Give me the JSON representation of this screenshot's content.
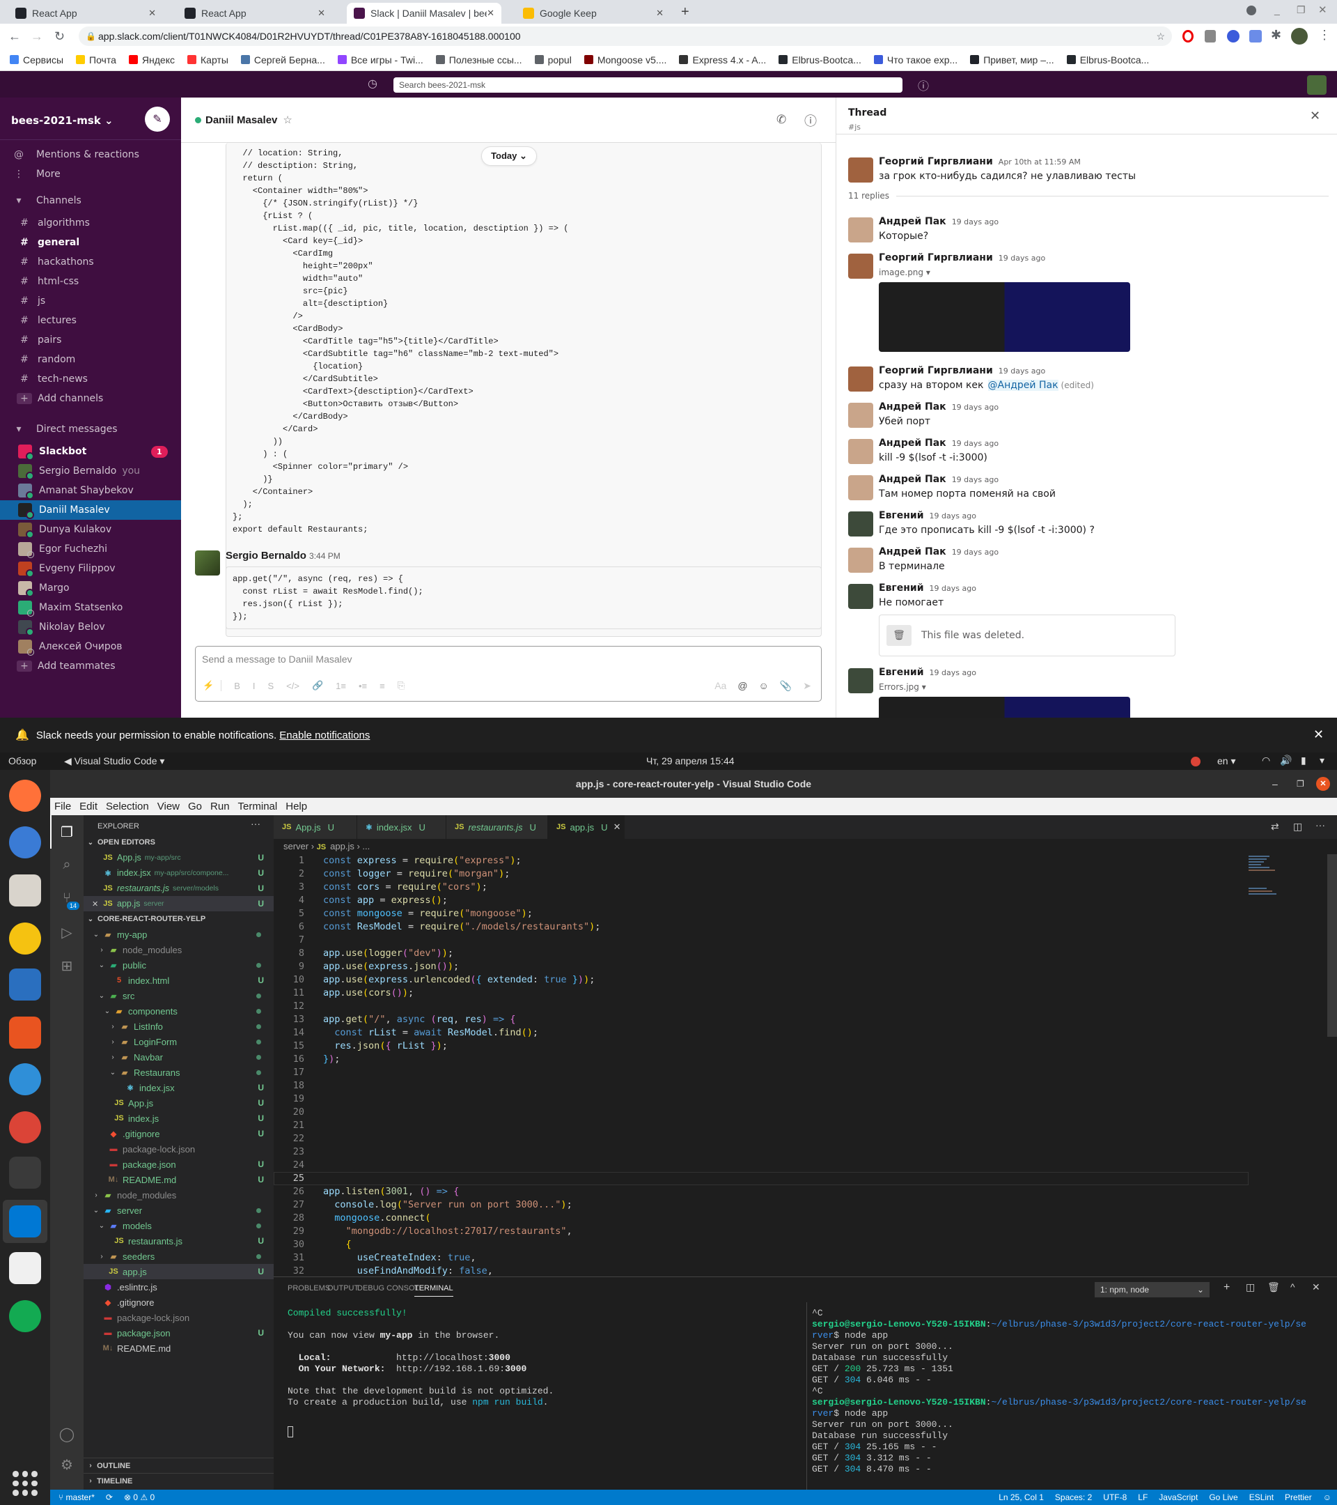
{
  "browser": {
    "tabs": [
      {
        "title": "React App",
        "color": "#20232a",
        "active": false
      },
      {
        "title": "React App",
        "color": "#20232a",
        "active": false
      },
      {
        "title": "Slack | Daniil Masalev | bees-2021-msk",
        "color": "#4a154b",
        "active": true
      },
      {
        "title": "Google Keep",
        "color": "#fbbc04",
        "active": false
      }
    ],
    "url": "app.slack.com/client/T01NWCK4084/D01R2HVUYDT/thread/C01PE378A8Y-1618045188.000100",
    "bookmarks": [
      {
        "label": "Сервисы",
        "color": "#4285f4"
      },
      {
        "label": "Почта",
        "color": "#ffcc00"
      },
      {
        "label": "Яндекс",
        "color": "#ff0000"
      },
      {
        "label": "Карты",
        "color": "#ff3333"
      },
      {
        "label": "Сергей Берна...",
        "color": "#4a76a8"
      },
      {
        "label": "Все игры - Twi...",
        "color": "#9146ff"
      },
      {
        "label": "Полезные ссы...",
        "color": "#5f6368"
      },
      {
        "label": "popul",
        "color": "#5f6368"
      },
      {
        "label": "Mongoose v5....",
        "color": "#800000"
      },
      {
        "label": "Express 4.x - A...",
        "color": "#333333"
      },
      {
        "label": "Elbrus-Bootca...",
        "color": "#24292e"
      },
      {
        "label": "Что такое exp...",
        "color": "#3b5bdb"
      },
      {
        "label": "Привет, мир –...",
        "color": "#20232a"
      },
      {
        "label": "Elbrus-Bootca...",
        "color": "#24292e"
      }
    ]
  },
  "slack": {
    "search_placeholder": "Search bees-2021-msk",
    "workspace": "bees-2021-msk",
    "mentions": "Mentions & reactions",
    "more": "More",
    "channels_header": "Channels",
    "channels": [
      "algorithms",
      "general",
      "hackathons",
      "html-css",
      "js",
      "lectures",
      "pairs",
      "random",
      "tech-news"
    ],
    "bold_channel": "general",
    "add_channels": "Add channels",
    "dm_header": "Direct messages",
    "dms": [
      {
        "name": "Slackbot",
        "badge": "1",
        "bold": true,
        "color": "#e01e5a"
      },
      {
        "name": "Sergio Bernaldo",
        "suffix": "you",
        "color": "#4b6b3a"
      },
      {
        "name": "Amanat Shaybekov",
        "color": "#6b7a99"
      },
      {
        "name": "Daniil Masalev",
        "selected": true,
        "color": "#222222"
      },
      {
        "name": "Dunya Kulakov",
        "color": "#7a5a3a"
      },
      {
        "name": "Egor Fuchezhi",
        "away": true,
        "color": "#b8a898"
      },
      {
        "name": "Evgeny Filippov",
        "color": "#c04020"
      },
      {
        "name": "Margo",
        "color": "#c8b8a8"
      },
      {
        "name": "Maxim Statsenko",
        "away": true,
        "color": "#2bac76"
      },
      {
        "name": "Nikolay Belov",
        "color": "#404850"
      },
      {
        "name": "Алексей Очиров",
        "away": true,
        "color": "#a08060"
      }
    ],
    "add_teammates": "Add teammates",
    "channel_title": "Daniil Masalev",
    "today": "Today",
    "code_message": "  // location: String,\n  // desctiption: String,\n  return (\n    <Container width=\"80%\">\n      {/* {JSON.stringify(rList)} */}\n      {rList ? (\n        rList.map(({ _id, pic, title, location, desctiption }) => (\n          <Card key={_id}>\n            <CardImg\n              height=\"200px\"\n              width=\"auto\"\n              src={pic}\n              alt={desctiption}\n            />\n            <CardBody>\n              <CardTitle tag=\"h5\">{title}</CardTitle>\n              <CardSubtitle tag=\"h6\" className=\"mb-2 text-muted\">\n                {location}\n              </CardSubtitle>\n              <CardText>{desctiption}</CardText>\n              <Button>Оставить отзыв</Button>\n            </CardBody>\n          </Card>\n        ))\n      ) : (\n        <Spinner color=\"primary\" />\n      )}\n    </Container>\n  );\n};\nexport default Restaurants;",
    "sergio": {
      "name": "Sergio Bernaldo",
      "time": "3:44 PM",
      "code": "app.get(\"/\", async (req, res) => {\n  const rList = await ResModel.find();\n  res.json({ rList });\n});"
    },
    "composer_placeholder": "Send a message to Daniil Masalev",
    "composer_tools": [
      "B",
      "I",
      "S",
      "</>",
      "🔗",
      "1≡",
      "•≡",
      "≡",
      "⎘"
    ],
    "composer_right": [
      "Aa",
      "@",
      "☺",
      "📎",
      "➤"
    ],
    "thread": {
      "title": "Thread",
      "channel": "#js",
      "parent": {
        "name": "Георгий Гиргвлиани",
        "time": "Apr 10th at 11:59 AM",
        "text": "за грок кто-нибудь садился? не улавливаю тесты"
      },
      "replies_label": "11 replies",
      "replies": [
        {
          "name": "Андрей Пак",
          "time": "19 days ago",
          "text": "Которые?",
          "av": "#c9a58a"
        },
        {
          "name": "Георгий Гиргвлиани",
          "time": "19 days ago",
          "file": "image.png",
          "av": "#a0623f"
        },
        {
          "name": "Георгий Гиргвлиани",
          "time": "19 days ago",
          "text": "сразу на втором кек",
          "mention": "@Андрей Пак",
          "edited": "(edited)",
          "av": "#a0623f"
        },
        {
          "name": "Андрей Пак",
          "time": "19 days ago",
          "text": "Убей порт",
          "av": "#c9a58a"
        },
        {
          "name": "Андрей Пак",
          "time": "19 days ago",
          "text": "kill -9 $(lsof -t -i:3000)",
          "av": "#c9a58a"
        },
        {
          "name": "Андрей Пак",
          "time": "19 days ago",
          "text": "Там  номер порта поменяй на свой",
          "av": "#c9a58a"
        },
        {
          "name": "Евгений",
          "time": "19 days ago",
          "text": "Где это прописать kill -9 $(lsof -t -i:3000) ?",
          "av": "#3d4a3a"
        },
        {
          "name": "Андрей Пак",
          "time": "19 days ago",
          "text": "В терминале",
          "av": "#c9a58a"
        },
        {
          "name": "Евгений",
          "time": "19 days ago",
          "text": "Не помогает",
          "deleted": "This file was deleted.",
          "av": "#3d4a3a"
        },
        {
          "name": "Евгений",
          "time": "19 days ago",
          "file": "Errors.jpg",
          "av": "#3d4a3a"
        }
      ]
    },
    "notification": {
      "text": "Slack needs your permission to enable notifications.",
      "link": "Enable notifications"
    }
  },
  "ubuntu": {
    "overview": "Обзор",
    "app": "Visual Studio Code",
    "datetime": "Чт, 29 апреля  15:44",
    "lang": "en"
  },
  "dock": [
    {
      "name": "firefox",
      "color": "#ff7139"
    },
    {
      "name": "thunderbird",
      "color": "#3a7bd5"
    },
    {
      "name": "files",
      "color": "#d9d4cc"
    },
    {
      "name": "rhythmbox",
      "color": "#f5c211"
    },
    {
      "name": "writer",
      "color": "#2a6fbf"
    },
    {
      "name": "app-center",
      "color": "#e95420"
    },
    {
      "name": "help",
      "color": "#2f8fd8"
    },
    {
      "name": "chrome",
      "color": "#db4437"
    },
    {
      "name": "terminal",
      "color": "#3a3a3a"
    },
    {
      "name": "vscode",
      "color": "#0078d4"
    },
    {
      "name": "text-editor",
      "color": "#f0f0f0"
    },
    {
      "name": "mongodb-compass",
      "color": "#13aa52"
    }
  ],
  "vscode": {
    "title": "app.js - core-react-router-yelp - Visual Studio Code",
    "menu": [
      "File",
      "Edit",
      "Selection",
      "View",
      "Go",
      "Run",
      "Terminal",
      "Help"
    ],
    "scm_badge": "14",
    "explorer_title": "EXPLORER",
    "open_editors_title": "OPEN EDITORS",
    "open_editors": [
      {
        "name": "App.js",
        "path": "my-app/src",
        "icon": "js",
        "status": "U"
      },
      {
        "name": "index.jsx",
        "path": "my-app/src/compone...",
        "icon": "react",
        "status": "U"
      },
      {
        "name": "restaurants.js",
        "path": "server/models",
        "icon": "js",
        "status": "U",
        "italic": true
      },
      {
        "name": "app.js",
        "path": "server",
        "icon": "js",
        "status": "U",
        "active": true
      }
    ],
    "project_title": "CORE-REACT-ROUTER-YELP",
    "tree": [
      {
        "name": "my-app",
        "d": 1,
        "chev": "open",
        "icon": "folder",
        "st": "dot",
        "c": "g"
      },
      {
        "name": "node_modules",
        "d": 2,
        "chev": "closed",
        "icon": "folder-node",
        "st": "",
        "c": "gray"
      },
      {
        "name": "public",
        "d": 2,
        "chev": "open",
        "icon": "folder-public",
        "st": "dot",
        "c": "g"
      },
      {
        "name": "index.html",
        "d": 3,
        "icon": "html",
        "st": "U",
        "c": "g"
      },
      {
        "name": "src",
        "d": 2,
        "chev": "open",
        "icon": "folder-src",
        "st": "dot",
        "c": "g"
      },
      {
        "name": "components",
        "d": 3,
        "chev": "open",
        "icon": "folder-comp",
        "st": "dot",
        "c": "g"
      },
      {
        "name": "ListInfo",
        "d": 4,
        "chev": "closed",
        "icon": "folder",
        "st": "dot",
        "c": "g"
      },
      {
        "name": "LoginForm",
        "d": 4,
        "chev": "closed",
        "icon": "folder",
        "st": "dot",
        "c": "g"
      },
      {
        "name": "Navbar",
        "d": 4,
        "chev": "closed",
        "icon": "folder",
        "st": "dot",
        "c": "g"
      },
      {
        "name": "Restaurans",
        "d": 4,
        "chev": "open",
        "icon": "folder",
        "st": "dot",
        "c": "g"
      },
      {
        "name": "index.jsx",
        "d": 5,
        "icon": "react",
        "st": "U",
        "c": "g"
      },
      {
        "name": "App.js",
        "d": 3,
        "icon": "js",
        "st": "U",
        "c": "g"
      },
      {
        "name": "index.js",
        "d": 3,
        "icon": "js",
        "st": "U",
        "c": "g"
      },
      {
        "name": ".gitignore",
        "d": 2,
        "icon": "git",
        "st": "U",
        "c": "g"
      },
      {
        "name": "package-lock.json",
        "d": 2,
        "icon": "npm",
        "st": "",
        "c": "gray"
      },
      {
        "name": "package.json",
        "d": 2,
        "icon": "npm",
        "st": "U",
        "c": "g"
      },
      {
        "name": "README.md",
        "d": 2,
        "icon": "md",
        "st": "U",
        "c": "g"
      },
      {
        "name": "node_modules",
        "d": 1,
        "chev": "closed",
        "icon": "folder-node",
        "st": "",
        "c": "gray"
      },
      {
        "name": "server",
        "d": 1,
        "chev": "open",
        "icon": "folder-server",
        "st": "dot",
        "c": "g"
      },
      {
        "name": "models",
        "d": 2,
        "chev": "open",
        "icon": "folder-models",
        "st": "dot",
        "c": "g"
      },
      {
        "name": "restaurants.js",
        "d": 3,
        "icon": "js",
        "st": "U",
        "c": "g"
      },
      {
        "name": "seeders",
        "d": 2,
        "chev": "closed",
        "icon": "folder",
        "st": "dot",
        "c": "g"
      },
      {
        "name": "app.js",
        "d": 2,
        "icon": "js",
        "st": "U",
        "c": "g",
        "sel": true
      },
      {
        "name": ".eslintrc.js",
        "d": 1,
        "icon": "eslint",
        "st": "",
        "c": "w"
      },
      {
        "name": ".gitignore",
        "d": 1,
        "icon": "git",
        "st": "",
        "c": "w"
      },
      {
        "name": "package-lock.json",
        "d": 1,
        "icon": "npm",
        "st": "",
        "c": "gray"
      },
      {
        "name": "package.json",
        "d": 1,
        "icon": "npm",
        "st": "U",
        "c": "g"
      },
      {
        "name": "README.md",
        "d": 1,
        "icon": "md",
        "st": "",
        "c": "w"
      }
    ],
    "outline": "OUTLINE",
    "timeline": "TIMELINE",
    "tabs": [
      {
        "name": "App.js",
        "status": "U",
        "icon": "js"
      },
      {
        "name": "index.jsx",
        "status": "U",
        "icon": "react"
      },
      {
        "name": "restaurants.js",
        "status": "U",
        "icon": "js",
        "italic": true
      },
      {
        "name": "app.js",
        "status": "U",
        "icon": "js",
        "active": true
      }
    ],
    "breadcrumb": [
      "server",
      "app.js",
      "..."
    ],
    "current_line": 25,
    "code": [
      "const express = require(\"express\");",
      "const logger = require(\"morgan\");",
      "const cors = require(\"cors\");",
      "const app = express();",
      "const mongoose = require(\"mongoose\");",
      "const ResModel = require(\"./models/restaurants\");",
      "",
      "app.use(logger(\"dev\"));",
      "app.use(express.json());",
      "app.use(express.urlencoded({ extended: true }));",
      "app.use(cors());",
      "",
      "app.get(\"/\", async (req, res) => {",
      "  const rList = await ResModel.find();",
      "  res.json({ rList });",
      "});",
      "",
      "",
      "",
      "",
      "",
      "",
      "",
      "",
      "",
      "app.listen(3001, () => {",
      "  console.log(\"Server run on port 3000...\");",
      "  mongoose.connect(",
      "    \"mongodb://localhost:27017/restaurants\",",
      "    {",
      "      useCreateIndex: true,",
      "      useFindAndModify: false,"
    ],
    "panel_tabs": [
      "PROBLEMS",
      "OUTPUT",
      "DEBUG CONSOLE",
      "TERMINAL"
    ],
    "terminal_select": "1: npm, node",
    "term_left": [
      [
        [
          "Compiled successfully!",
          "g"
        ]
      ],
      [],
      [
        [
          "You can now view ",
          ""
        ],
        [
          "my-app",
          "b"
        ],
        [
          " in the browser.",
          ""
        ]
      ],
      [],
      [
        [
          "  ",
          ""
        ],
        [
          "Local:",
          "b"
        ],
        [
          "            http://localhost:",
          ""
        ],
        [
          "3000",
          "b"
        ]
      ],
      [
        [
          "  ",
          ""
        ],
        [
          "On Your Network:",
          "b"
        ],
        [
          "  http://192.168.1.69:",
          ""
        ],
        [
          "3000",
          "b"
        ]
      ],
      [],
      [
        [
          "Note that the development build is not optimized.",
          ""
        ]
      ],
      [
        [
          "To create a production build, use ",
          ""
        ],
        [
          "npm run build",
          "cy"
        ],
        [
          ".",
          ""
        ]
      ]
    ],
    "term_right": [
      [
        [
          "^C",
          ""
        ]
      ],
      [
        [
          "sergio@sergio-Lenovo-Y520-15IKBN",
          "gb"
        ],
        [
          ":",
          ""
        ],
        [
          "~/elbrus/phase-3/p3w1d3/project2/core-react-router-yelp/se",
          "bl"
        ]
      ],
      [
        [
          "rver",
          "bl"
        ],
        [
          "$ node app",
          ""
        ]
      ],
      [
        [
          "Server run on port 3000...",
          ""
        ]
      ],
      [
        [
          "Database run successfully",
          ""
        ]
      ],
      [
        [
          "GET / ",
          ""
        ],
        [
          "200",
          "g"
        ],
        [
          " 25.723 ms - 1351",
          ""
        ]
      ],
      [
        [
          "GET / ",
          ""
        ],
        [
          "304",
          "cy"
        ],
        [
          " 6.046 ms - -",
          ""
        ]
      ],
      [
        [
          "^C",
          ""
        ]
      ],
      [
        [
          "sergio@sergio-Lenovo-Y520-15IKBN",
          "gb"
        ],
        [
          ":",
          ""
        ],
        [
          "~/elbrus/phase-3/p3w1d3/project2/core-react-router-yelp/se",
          "bl"
        ]
      ],
      [
        [
          "rver",
          "bl"
        ],
        [
          "$ node app",
          ""
        ]
      ],
      [
        [
          "Server run on port 3000...",
          ""
        ]
      ],
      [
        [
          "Database run successfully",
          ""
        ]
      ],
      [
        [
          "GET / ",
          ""
        ],
        [
          "304",
          "cy"
        ],
        [
          " 25.165 ms - -",
          ""
        ]
      ],
      [
        [
          "GET / ",
          ""
        ],
        [
          "304",
          "cy"
        ],
        [
          " 3.312 ms - -",
          ""
        ]
      ],
      [
        [
          "GET / ",
          ""
        ],
        [
          "304",
          "cy"
        ],
        [
          " 8.470 ms - -",
          ""
        ]
      ]
    ],
    "status": {
      "branch": "master*",
      "errors": "⊗ 0 ⚠ 0",
      "right": [
        "Ln 25, Col 1",
        "Spaces: 2",
        "UTF-8",
        "LF",
        "JavaScript",
        "Go Live",
        "ESLint",
        "Prettier"
      ]
    }
  }
}
